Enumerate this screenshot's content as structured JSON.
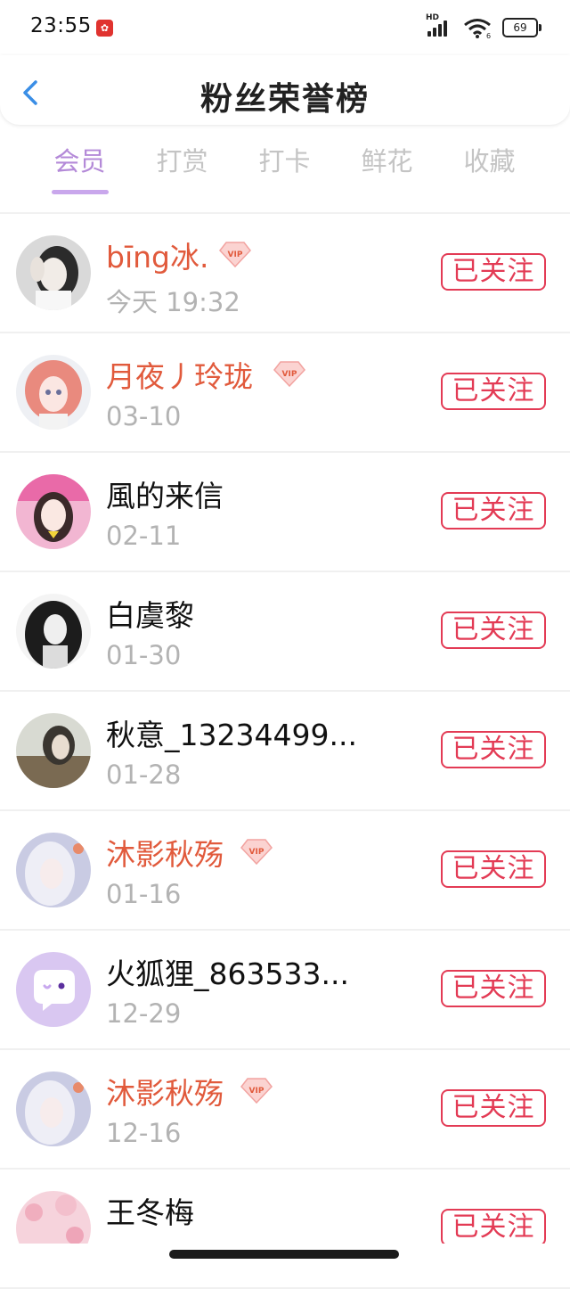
{
  "status_bar": {
    "time": "23:55",
    "network_label": "HD",
    "battery": "69",
    "icons": [
      "app-notification-icon",
      "signal-icon",
      "wifi-icon",
      "battery-icon"
    ]
  },
  "header": {
    "title": "粉丝荣誉榜",
    "back_icon": "chevron-left-icon"
  },
  "tabs": [
    {
      "label": "会员",
      "active": true
    },
    {
      "label": "打赏",
      "active": false
    },
    {
      "label": "打卡",
      "active": false
    },
    {
      "label": "鲜花",
      "active": false
    },
    {
      "label": "收藏",
      "active": false
    }
  ],
  "users": [
    {
      "name": "bīng冰.",
      "vip": true,
      "date": "今天 19:32",
      "button": "已关注"
    },
    {
      "name": "月夜丿玲珑",
      "vip": true,
      "date": "03-10",
      "button": "已关注"
    },
    {
      "name": "風的来信",
      "vip": false,
      "date": "02-11",
      "button": "已关注"
    },
    {
      "name": "白虞黎",
      "vip": false,
      "date": "01-30",
      "button": "已关注"
    },
    {
      "name": "秋意_13234499...",
      "vip": false,
      "date": "01-28",
      "button": "已关注"
    },
    {
      "name": "沐影秋殇",
      "vip": true,
      "date": "01-16",
      "button": "已关注"
    },
    {
      "name": "火狐狸_863533...",
      "vip": false,
      "date": "12-29",
      "button": "已关注"
    },
    {
      "name": "沐影秋殇",
      "vip": true,
      "date": "12-16",
      "button": "已关注"
    },
    {
      "name": "王冬梅",
      "vip": false,
      "date": "",
      "button": "已关注"
    }
  ],
  "badge_text": "VIP",
  "colors": {
    "accent": "#b48ad8",
    "vip_name": "#e15a3c",
    "follow": "#e33b55",
    "muted": "#b3b3b3"
  }
}
